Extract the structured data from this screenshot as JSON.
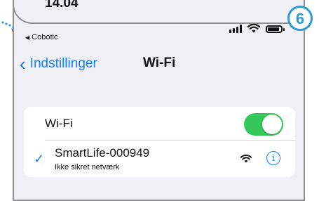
{
  "status_bar": {
    "time": "14.04",
    "back_app": "Cobotic"
  },
  "nav": {
    "back_label": "Indstillinger",
    "title": "Wi-Fi"
  },
  "wifi_row": {
    "label": "Wi-Fi",
    "toggle_on": true
  },
  "network": {
    "ssid": "SmartLife-000949",
    "subtitle": "Ikke sikret netværk",
    "info_glyph": "i"
  },
  "annotation": {
    "step_number": "6"
  },
  "colors": {
    "ios_blue": "#147efb",
    "toggle_green": "#34c759",
    "annotation_blue": "#2b9ad6"
  },
  "icons": [
    "back-triangle-icon",
    "signal-icon",
    "wifi-icon",
    "battery-icon",
    "chevron-left-icon",
    "checkmark-icon",
    "wifi-strength-icon",
    "info-icon"
  ]
}
